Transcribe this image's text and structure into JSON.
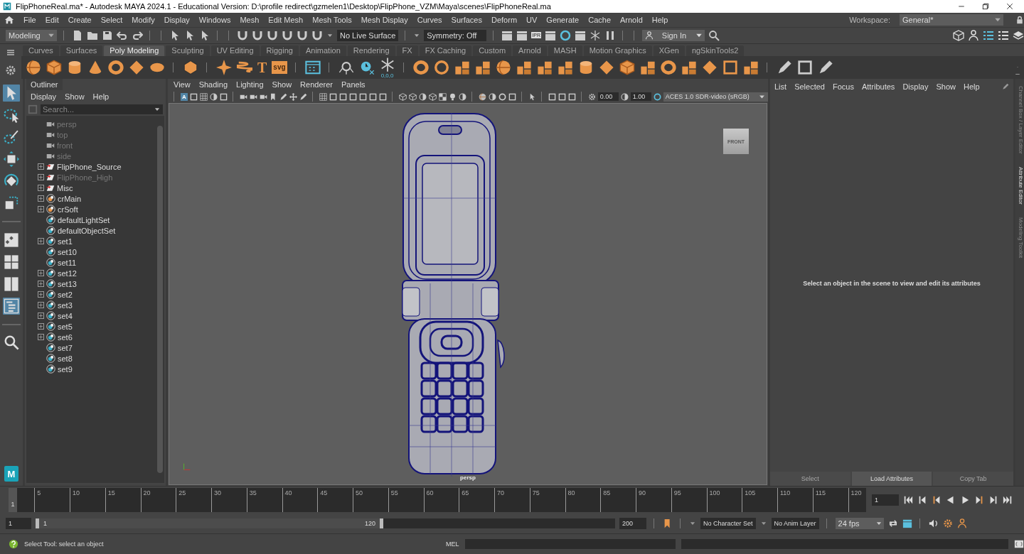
{
  "window": {
    "title": "FlipPhoneReal.ma* - Autodesk MAYA 2024.1 - Educational Version: D:\\profile redirect\\gzmelen1\\Desktop\\FlipPhone_VZM\\Maya\\scenes\\FlipPhoneReal.ma"
  },
  "menu_bar": {
    "items": [
      "File",
      "Edit",
      "Create",
      "Select",
      "Modify",
      "Display",
      "Windows",
      "Mesh",
      "Edit Mesh",
      "Mesh Tools",
      "Mesh Display",
      "Curves",
      "Surfaces",
      "Deform",
      "UV",
      "Generate",
      "Cache",
      "Arnold",
      "Help"
    ],
    "workspace_label": "Workspace:",
    "workspace": "General*"
  },
  "status_line": {
    "mode": "Modeling",
    "live_surface": "No Live Surface",
    "symmetry": "Symmetry: Off",
    "render_badge": "IPR",
    "sign_in": "Sign In"
  },
  "shelf": {
    "tabs": [
      {
        "label": "Curves",
        "selected": false
      },
      {
        "label": "Surfaces",
        "selected": false
      },
      {
        "label": "Poly Modeling",
        "selected": true
      },
      {
        "label": "Sculpting",
        "selected": false
      },
      {
        "label": "UV Editing",
        "selected": false
      },
      {
        "label": "Rigging",
        "selected": false
      },
      {
        "label": "Animation",
        "selected": false
      },
      {
        "label": "Rendering",
        "selected": false
      },
      {
        "label": "FX",
        "selected": false
      },
      {
        "label": "FX Caching",
        "selected": false
      },
      {
        "label": "Custom",
        "selected": false
      },
      {
        "label": "Arnold",
        "selected": false
      },
      {
        "label": "MASH",
        "selected": false
      },
      {
        "label": "Motion Graphics",
        "selected": false
      },
      {
        "label": "XGen",
        "selected": false
      },
      {
        "label": "ngSkinTools2",
        "selected": false
      }
    ],
    "glyphs": [
      "T",
      "svg",
      "0,0,0"
    ]
  },
  "toolbox": {
    "tools": [
      {
        "kind": "select",
        "selected": true
      },
      {
        "kind": "lasso",
        "selected": false
      },
      {
        "kind": "paint",
        "selected": false
      },
      {
        "kind": "move",
        "selected": false
      },
      {
        "kind": "rotate",
        "selected": false
      },
      {
        "kind": "scale",
        "selected": false
      }
    ],
    "layouts": [
      {
        "kind": "single",
        "selected": false
      },
      {
        "kind": "four",
        "selected": false
      },
      {
        "kind": "two",
        "selected": false
      },
      {
        "kind": "outliner",
        "selected": true
      }
    ],
    "logo": "M"
  },
  "outliner": {
    "title": "Outliner",
    "menus": [
      "Display",
      "Show",
      "Help"
    ],
    "search": {
      "placeholder": "Search..."
    },
    "items": [
      {
        "label": "persp",
        "kind": "camera",
        "expandable": false,
        "dimmed": true
      },
      {
        "label": "top",
        "kind": "camera",
        "expandable": false,
        "dimmed": true
      },
      {
        "label": "front",
        "kind": "camera",
        "expandable": false,
        "dimmed": true
      },
      {
        "label": "side",
        "kind": "camera",
        "expandable": false,
        "dimmed": true
      },
      {
        "label": "FlipPhone_Source",
        "kind": "layer",
        "expandable": true,
        "dimmed": false
      },
      {
        "label": "FlipPhone_High",
        "kind": "layer",
        "expandable": true,
        "dimmed": true
      },
      {
        "label": "Misc",
        "kind": "layer",
        "expandable": true,
        "dimmed": false
      },
      {
        "label": "crMain",
        "kind": "creaseset",
        "expandable": true,
        "dimmed": false
      },
      {
        "label": "crSoft",
        "kind": "creaseset",
        "expandable": true,
        "dimmed": false
      },
      {
        "label": "defaultLightSet",
        "kind": "set",
        "expandable": false,
        "dimmed": false
      },
      {
        "label": "defaultObjectSet",
        "kind": "set",
        "expandable": false,
        "dimmed": false
      },
      {
        "label": "set1",
        "kind": "set",
        "expandable": true,
        "dimmed": false
      },
      {
        "label": "set10",
        "kind": "set",
        "expandable": false,
        "dimmed": false
      },
      {
        "label": "set11",
        "kind": "set",
        "expandable": false,
        "dimmed": false
      },
      {
        "label": "set12",
        "kind": "set",
        "expandable": true,
        "dimmed": false
      },
      {
        "label": "set13",
        "kind": "set",
        "expandable": true,
        "dimmed": false
      },
      {
        "label": "set2",
        "kind": "set",
        "expandable": true,
        "dimmed": false
      },
      {
        "label": "set3",
        "kind": "set",
        "expandable": true,
        "dimmed": false
      },
      {
        "label": "set4",
        "kind": "set",
        "expandable": true,
        "dimmed": false
      },
      {
        "label": "set5",
        "kind": "set",
        "expandable": true,
        "dimmed": false
      },
      {
        "label": "set6",
        "kind": "set",
        "expandable": true,
        "dimmed": false
      },
      {
        "label": "set7",
        "kind": "set",
        "expandable": false,
        "dimmed": false
      },
      {
        "label": "set8",
        "kind": "set",
        "expandable": false,
        "dimmed": false
      },
      {
        "label": "set9",
        "kind": "set",
        "expandable": false,
        "dimmed": false
      }
    ]
  },
  "viewport": {
    "menus": [
      "View",
      "Shading",
      "Lighting",
      "Show",
      "Renderer",
      "Panels"
    ],
    "toolbar_glyph": "A",
    "exposure": "0.00",
    "gamma": "1.00",
    "color_space": "ACES 1.0 SDR-video (sRGB)",
    "view_cube": "FRONT",
    "camera": "persp"
  },
  "attribute_editor": {
    "menus": [
      "List",
      "Selected",
      "Focus",
      "Attributes",
      "Display",
      "Show",
      "Help"
    ],
    "message": "Select an object in the scene to view and edit its attributes",
    "buttons": [
      {
        "label": "Select",
        "disabled": true
      },
      {
        "label": "Load Attributes",
        "disabled": false
      },
      {
        "label": "Copy Tab",
        "disabled": true
      }
    ]
  },
  "side_tabs": [
    {
      "label": "Channel Box / Layer Editor",
      "selected": false
    },
    {
      "label": "Attribute Editor",
      "selected": true
    },
    {
      "label": "Modeling Toolkit",
      "selected": false
    }
  ],
  "time_slider": {
    "labels": [
      "5",
      "10",
      "15",
      "20",
      "25",
      "30",
      "35",
      "40",
      "45",
      "50",
      "55",
      "60",
      "65",
      "70",
      "75",
      "80",
      "85",
      "90",
      "95",
      "100",
      "105",
      "110",
      "115",
      "120"
    ],
    "current_frame": "1",
    "level": 0,
    "current_field": "1"
  },
  "range_slider": {
    "start": "1",
    "range_start": "1",
    "range_end": "120",
    "end": "200",
    "level": 0.6,
    "character_set": "No Character Set",
    "anim_layer": "No Anim Layer",
    "fps": "24 fps"
  },
  "help_line": {
    "message": "Select Tool: select an object",
    "command_label": "MEL"
  }
}
